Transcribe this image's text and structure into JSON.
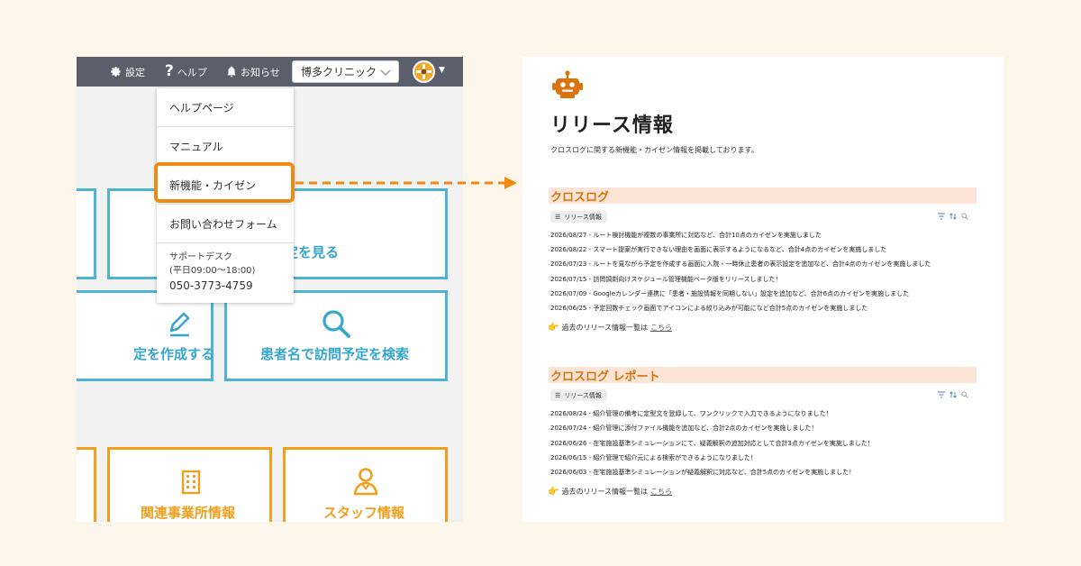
{
  "topbar": {
    "settings_label": "設定",
    "help_label": "ヘルプ",
    "notice_label": "お知らせ",
    "clinic_select_value": "博多クリニック"
  },
  "tiles": {
    "view_label_partial": "定を見る",
    "create_label_partial": "定を作成する",
    "search_label": "患者名で訪問予定を検索",
    "facility_label": "関連事業所情報",
    "staff_label": "スタッフ情報"
  },
  "help_menu": {
    "items": [
      "ヘルプページ",
      "マニュアル",
      "新機能・カイゼン",
      "お問い合わせフォーム"
    ],
    "support_title": "サポートデスク",
    "support_hours": "(平日09:00〜18:00)",
    "support_phone": "050-3773-4759"
  },
  "release_page": {
    "icon": "robot-icon",
    "title": "リリース情報",
    "description": "クロスログに関する新機能・カイゼン情報を掲載しております。",
    "sections": [
      {
        "heading": "クロスログ",
        "view_tab": "リリース情報",
        "items": [
          "2026/08/27 - ルート検討機能が複数の事業所に対応など、合計10点のカイゼンを実施しました",
          "2026/08/22 - スマート提案が実行できない理由を画面に表示するようになるなど、合計4点のカイゼンを実施しました",
          "2026/07/23 - ルートを見ながら予定を作成する画面に入院・一時休止患者の表示設定を追加など、合計4点のカイゼンを実施しました",
          "2026/07/15 - 訪問調剤向けスケジュール管理機能ベータ版をリリースしました！",
          "2026/07/09 - Googleカレンダー連携に「患者・施設情報を同期しない」設定を追加など、合計6点のカイゼンを実施しました",
          "2026/06/25 - 予定回数チェック画面でアイコンによる絞り込みが可能になど合計5点のカイゼンを実施しました"
        ],
        "past_text": "過去のリリース情報一覧は",
        "past_link": "こちら"
      },
      {
        "heading": "クロスログ レポート",
        "view_tab": "リリース情報",
        "items": [
          "2026/08/24 - 紹介管理の備考に定型文を登録して、ワンクリックで入力できるようになりました！",
          "2026/07/24 - 紹介管理に添付ファイル機能を追加など、合計2点のカイゼンを実施しました！",
          "2026/06/26 - 在宅施設基準シミュレーションにて、疑義解釈の追加対応として合計3点カイゼンを実施しました！",
          "2026/06/15 - 紹介管理で紹介元による検索ができるようになりました！",
          "2026/06/03 - 在宅施設基準シミュレーションが疑義解釈に対応など、合計5点のカイゼンを実施しました！"
        ],
        "past_text": "過去のリリース情報一覧は",
        "past_link": "こちら"
      }
    ]
  },
  "colors": {
    "background": "#fdf6ea",
    "topbar": "#5b5f6c",
    "blue_tile": "#4db4d6",
    "orange_tile": "#f0a01e",
    "highlight": "#f08a12",
    "section_bg": "#fbe4d5",
    "section_text": "#d9730d"
  }
}
